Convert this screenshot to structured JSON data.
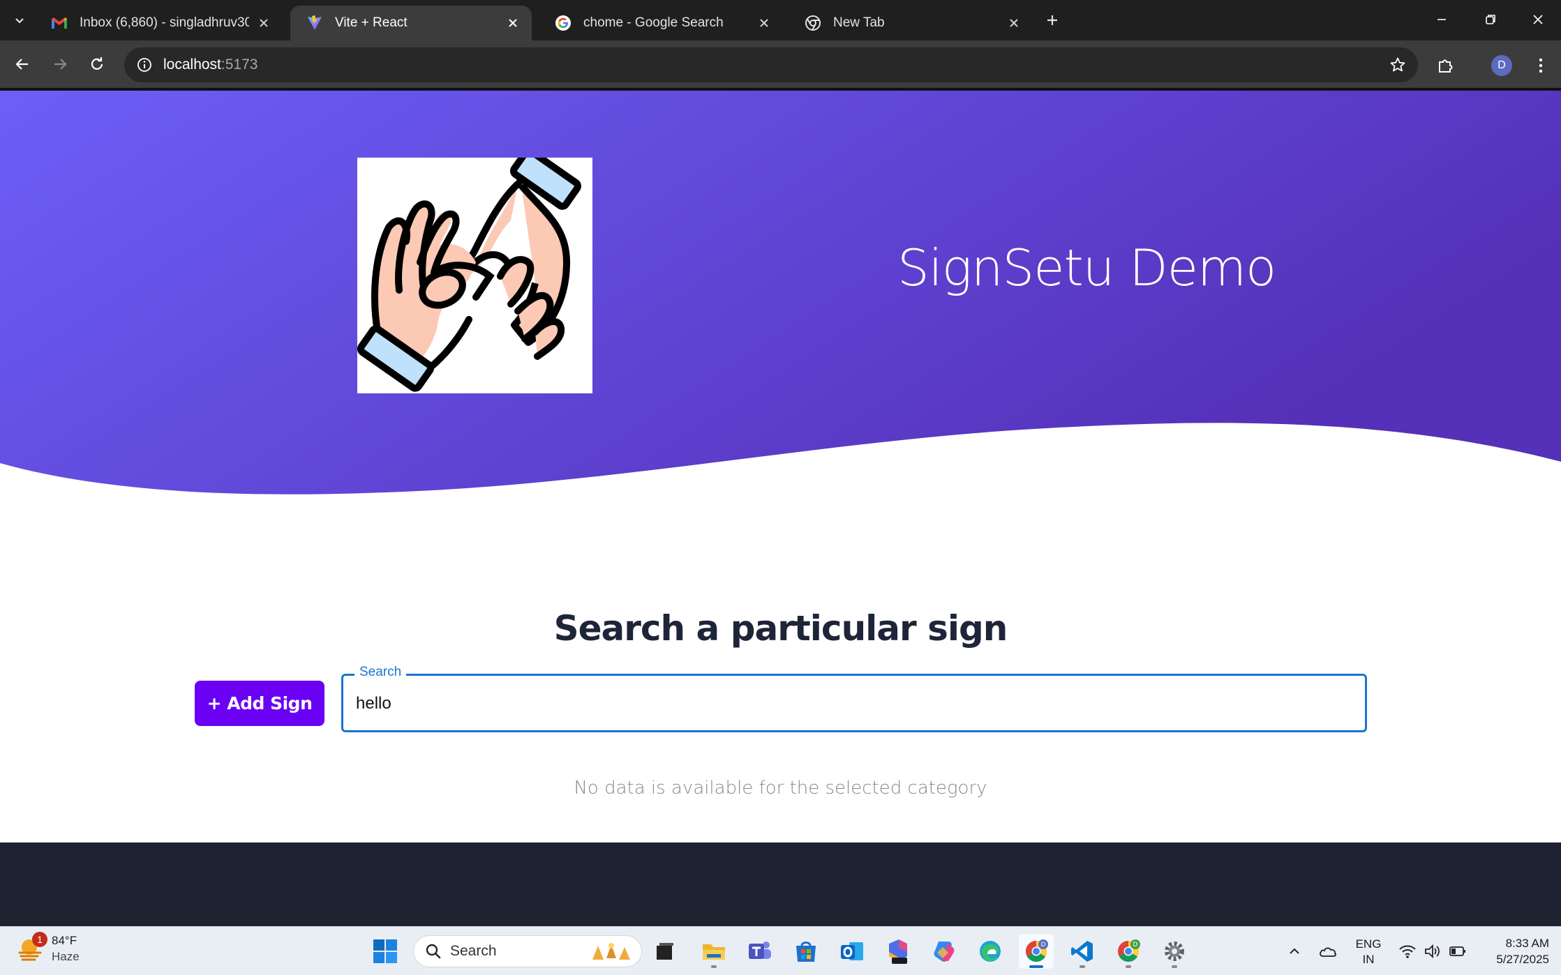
{
  "browser": {
    "tabs": [
      {
        "title": "Inbox (6,860) - singladhruv301@",
        "favicon": "gmail-icon",
        "active": false
      },
      {
        "title": "Vite + React",
        "favicon": "vite-icon",
        "active": true
      },
      {
        "title": "chome - Google Search",
        "favicon": "google-icon",
        "active": false
      },
      {
        "title": "New Tab",
        "favicon": "chrome-icon",
        "active": false
      }
    ],
    "url_host": "localhost",
    "url_port": ":5173",
    "profile_initial": "D"
  },
  "page": {
    "hero_title": "SignSetu Demo",
    "hero_colors": {
      "start": "#6c5ff7",
      "end": "#5530b8"
    },
    "search_heading": "Search a particular sign",
    "add_button_label": "+ Add Sign",
    "search_label": "Search",
    "search_value": "hello",
    "empty_message": "No data is available for the selected category",
    "accent_color": "#6a00f4"
  },
  "taskbar": {
    "weather_temp": "84°F",
    "weather_condition": "Haze",
    "weather_badge": "1",
    "search_placeholder": "Search",
    "lang_line1": "ENG",
    "lang_line2": "IN",
    "time": "8:33 AM",
    "date": "5/27/2025"
  }
}
